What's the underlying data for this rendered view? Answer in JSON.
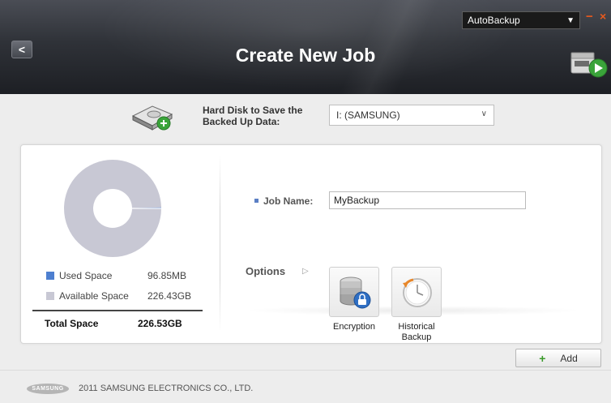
{
  "header": {
    "title": "Create New Job",
    "back_label": "<",
    "app_selector": {
      "selected": "AutoBackup"
    },
    "min_label": "−",
    "close_label": "×"
  },
  "hard_disk": {
    "label": "Hard Disk to Save the Backed Up Data:",
    "selected": "I: (SAMSUNG)"
  },
  "storage": {
    "used_label": "Used Space",
    "used_value": "96.85MB",
    "available_label": "Available Space",
    "available_value": "226.43GB",
    "total_label": "Total Space",
    "total_value": "226.53GB",
    "colors": {
      "used": "#4d7fd0",
      "available": "#c8c8d4"
    },
    "used_fraction": 0.0004
  },
  "job": {
    "name_label": "Job Name:",
    "name_value": "MyBackup"
  },
  "options": {
    "label": "Options",
    "items": [
      {
        "label": "Encryption",
        "icon": "database-lock-icon"
      },
      {
        "label": "Historical Backup",
        "icon": "history-clock-icon"
      }
    ]
  },
  "actions": {
    "add_label": "Add"
  },
  "footer": {
    "brand": "SAMSUNG",
    "copyright": "2011 SAMSUNG ELECTRONICS CO., LTD."
  }
}
